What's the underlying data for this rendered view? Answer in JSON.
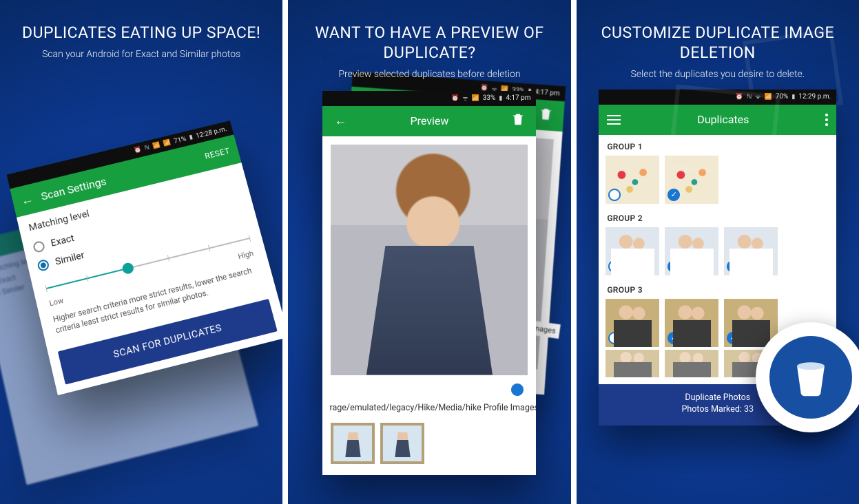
{
  "panel1": {
    "heading": "DUPLICATES EATING UP SPACE!",
    "subheading": "Scan your Android for Exact and Similar photos",
    "status": {
      "battery": "71%",
      "time": "12:28 p.m."
    },
    "appbar": {
      "title": "Scan Settings",
      "reset": "RESET"
    },
    "section_label": "Matching level",
    "radio_exact": "Exact",
    "radio_similar": "Similer",
    "slider_low": "Low",
    "slider_high": "High",
    "help_text": "Higher search criteria more strict results, lower the search criteria least strict results for similar photos.",
    "scan_button": "SCAN FOR DUPLICATES"
  },
  "panel2": {
    "heading": "WANT TO HAVE A PREVIEW OF DUPLICATE?",
    "subheading": "Preview selected duplicates before deletion",
    "status": {
      "battery": "33%",
      "time": "4:17 pm"
    },
    "appbar_title": "Preview",
    "file_path": "rage/emulated/legacy/Hike/Media/hike Profile Images",
    "ghost_file_path": "mages"
  },
  "panel3": {
    "heading": "CUSTOMIZE DUPLICATE IMAGE DELETION",
    "subheading": "Select the duplicates you desire to delete.",
    "status": {
      "battery": "70%",
      "time": "12:29 p.m."
    },
    "appbar_title": "Duplicates",
    "groups": {
      "g1": "GROUP 1",
      "g2": "GROUP 2",
      "g3": "GROUP 3"
    },
    "footer": {
      "line1": "Duplicate Photos",
      "line2": "Photos Marked: 33"
    }
  }
}
